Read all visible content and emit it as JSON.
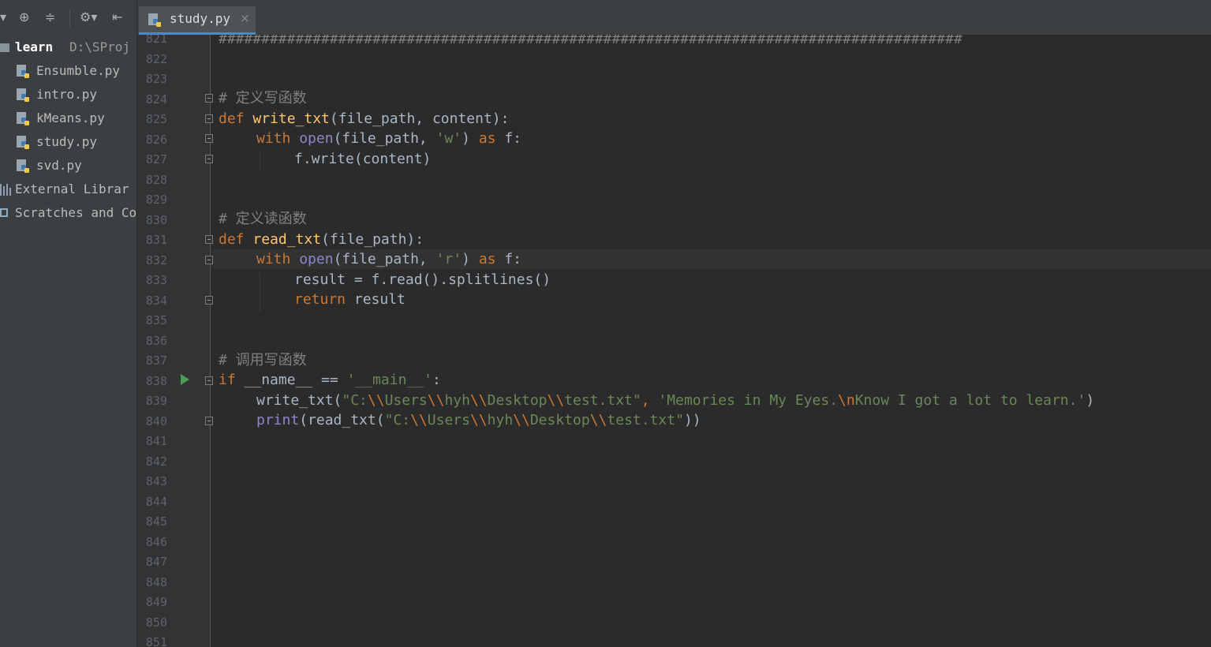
{
  "toolbar": {
    "icons": [
      "dropdown-arrow-icon",
      "locate-icon",
      "collapse-all-icon",
      "settings-gear-icon",
      "hide-panel-icon"
    ]
  },
  "project_tree": {
    "root": {
      "name": "learn",
      "path": "D:\\SProj"
    },
    "files": [
      "Ensumble.py",
      "intro.py",
      "kMeans.py",
      "study.py",
      "svd.py"
    ],
    "external_libraries": "External Librar",
    "scratches": "Scratches and Co"
  },
  "tabs": [
    {
      "label": "study.py",
      "close": "×"
    }
  ],
  "editor": {
    "line_numbers": [
      "821",
      "822",
      "823",
      "824",
      "825",
      "826",
      "827",
      "828",
      "829",
      "830",
      "831",
      "832",
      "833",
      "834",
      "835",
      "836",
      "837",
      "838",
      "839",
      "840",
      "841",
      "842",
      "843",
      "844",
      "845",
      "846",
      "847",
      "848",
      "849",
      "850",
      "851"
    ],
    "lines": {
      "l821": "#######################################################################################",
      "l824": "# 定义写函数",
      "l825": {
        "kw": "def",
        "fn": "write_txt",
        "rest": "(file_path, content):"
      },
      "l826": {
        "kw": "with",
        "bi": "open",
        "a": "(file_path, ",
        "str": "'w'",
        "b": ") ",
        "kw2": "as",
        "c": " f:"
      },
      "l827": "f.write(content)",
      "l830": "# 定义读函数",
      "l831": {
        "kw": "def",
        "fn": "read_txt",
        "rest": "(file_path):"
      },
      "l832": {
        "kw": "with",
        "bi": "open",
        "a": "(file_path, ",
        "str": "'r'",
        "b": ") ",
        "kw2": "as",
        "c": " f:"
      },
      "l833": "result = f.read().splitlines()",
      "l834": {
        "kw": "return",
        "rest": " result"
      },
      "l837": "# 调用写函数",
      "l838": {
        "kw": "if",
        "a": " __name__ == ",
        "str": "'__main__'",
        "b": ":"
      },
      "l839": {
        "a": "write_txt(",
        "s1": "\"C:",
        "e1": "\\\\",
        "s2": "Users",
        "e2": "\\\\",
        "s3": "hyh",
        "e3": "\\\\",
        "s4": "Desktop",
        "e4": "\\\\",
        "s5": "test.txt\"",
        "b": ", ",
        "s6": "'Memories in My Eyes.",
        "e5": "\\n",
        "s7": "Know I got a lot to learn.'",
        "c": ")"
      },
      "l840": {
        "bi": "print",
        "a": "(read_txt(",
        "s1": "\"C:",
        "e1": "\\\\",
        "s2": "Users",
        "e2": "\\\\",
        "s3": "hyh",
        "e3": "\\\\",
        "s4": "Desktop",
        "e4": "\\\\",
        "s5": "test.txt\"",
        "c": "))"
      }
    }
  },
  "colors": {
    "keyword": "#cc7832",
    "function": "#ffc66d",
    "builtin": "#8888c6",
    "string": "#6a8759",
    "comment": "#808080",
    "text": "#a9b7c6",
    "background": "#2b2b2b"
  }
}
